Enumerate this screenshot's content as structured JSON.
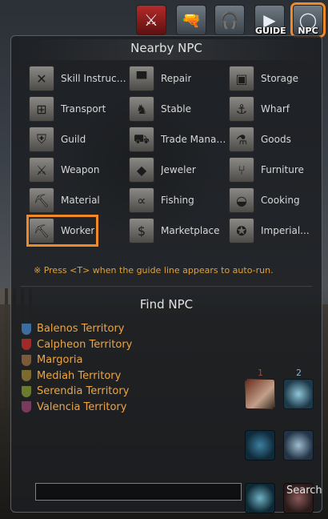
{
  "toolbar": {
    "buttons": [
      {
        "name": "combat-button",
        "icon": "crossed-swords-icon",
        "label": ""
      },
      {
        "name": "pet-button",
        "icon": "whistle-icon",
        "label": ""
      },
      {
        "name": "audio-button",
        "icon": "headset-icon",
        "label": ""
      },
      {
        "name": "guide-button",
        "icon": "play-icon",
        "label": "GUIDE"
      },
      {
        "name": "npc-button",
        "icon": "npc-ring-icon",
        "label": "NPC"
      }
    ]
  },
  "nearby": {
    "title": "Nearby NPC",
    "items": [
      {
        "label": "Skill Instructor",
        "icon": "crossed-axes-icon"
      },
      {
        "label": "Repair",
        "icon": "anvil-icon"
      },
      {
        "label": "Storage",
        "icon": "chest-icon"
      },
      {
        "label": "Transport",
        "icon": "gift-box-icon"
      },
      {
        "label": "Stable",
        "icon": "horse-head-icon"
      },
      {
        "label": "Wharf",
        "icon": "anchor-icon"
      },
      {
        "label": "Guild",
        "icon": "guild-crest-icon"
      },
      {
        "label": "Trade Manage...",
        "icon": "cart-icon"
      },
      {
        "label": "Goods",
        "icon": "potion-icon"
      },
      {
        "label": "Weapon",
        "icon": "sword-shield-icon"
      },
      {
        "label": "Jeweler",
        "icon": "diamond-icon"
      },
      {
        "label": "Furniture",
        "icon": "chair-icon"
      },
      {
        "label": "Material",
        "icon": "pickaxe-icon"
      },
      {
        "label": "Fishing",
        "icon": "fish-icon"
      },
      {
        "label": "Cooking",
        "icon": "pot-icon"
      },
      {
        "label": "Worker",
        "icon": "worker-pickaxe-icon"
      },
      {
        "label": "Marketplace",
        "icon": "money-bag-icon"
      },
      {
        "label": "Imperial...",
        "icon": "imperial-seal-icon"
      }
    ],
    "hint": "※ Press <T> when the guide line appears to auto-run."
  },
  "find": {
    "title": "Find NPC",
    "territories": [
      {
        "label": "Balenos Territory",
        "color": "#3b6e9e"
      },
      {
        "label": "Calpheon Territory",
        "color": "#9e2a2a"
      },
      {
        "label": "Margoria",
        "color": "#7a5a3a"
      },
      {
        "label": "Mediah Territory",
        "color": "#7c6a2e"
      },
      {
        "label": "Serendia Territory",
        "color": "#6a7a2e"
      },
      {
        "label": "Valencia Territory",
        "color": "#7a3a5e"
      }
    ],
    "search_placeholder": "",
    "search_label": "Search"
  },
  "skills": {
    "slot1": "1",
    "slot2": "2"
  },
  "colors": {
    "highlight": "#f08a28",
    "territory_text": "#f0a440"
  }
}
